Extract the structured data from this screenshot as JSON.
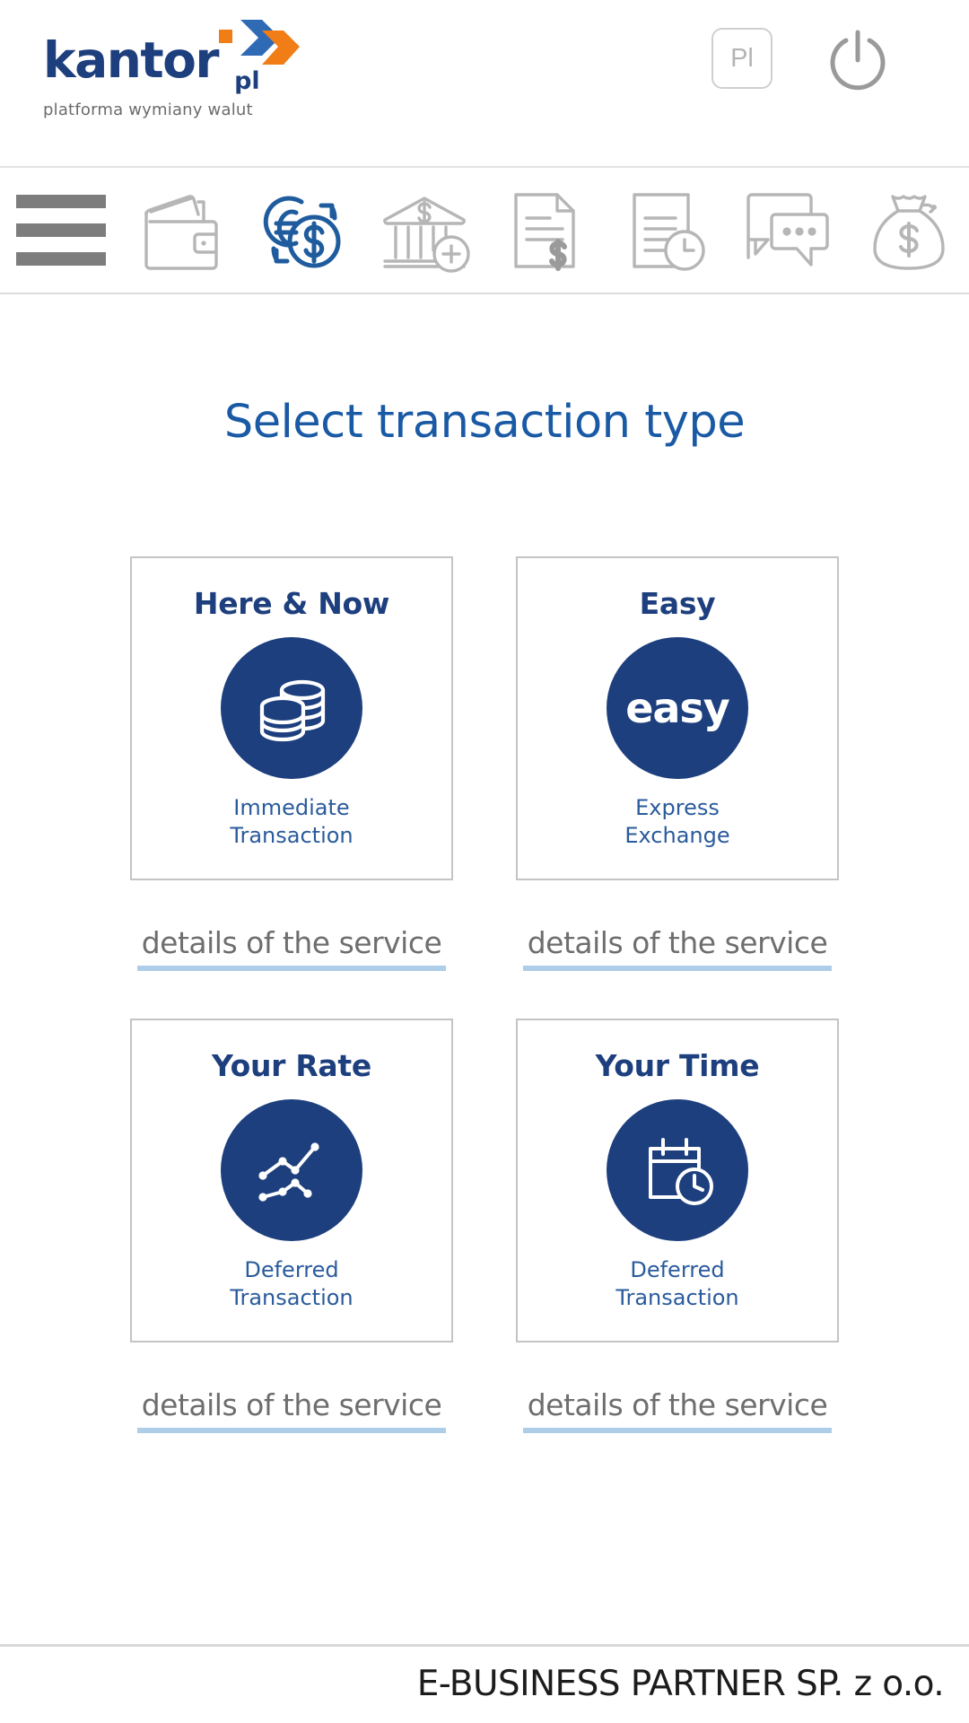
{
  "header": {
    "logo": {
      "word": "kantor",
      "dot_icon": "orange-square-dot",
      "tld": "pl",
      "tagline": "platforma wymiany walut",
      "chevron_icon": "double-chevron-logo",
      "blue": "#1d3f7e",
      "orange": "#f07d16"
    },
    "language_button": {
      "label": "Pl",
      "name": "language-switch-button"
    },
    "power_button": {
      "icon": "power-icon",
      "name": "logout-power-button"
    }
  },
  "nav": {
    "items": [
      {
        "icon": "hamburger-menu-icon",
        "name": "nav-menu-toggle",
        "active": false
      },
      {
        "icon": "wallet-icon",
        "name": "nav-item-wallet",
        "active": false
      },
      {
        "icon": "currency-exchange-icon",
        "name": "nav-item-exchange",
        "active": true
      },
      {
        "icon": "bank-add-icon",
        "name": "nav-item-bank-accounts",
        "active": false
      },
      {
        "icon": "invoice-dollar-icon",
        "name": "nav-item-invoices",
        "active": false
      },
      {
        "icon": "document-clock-icon",
        "name": "nav-item-history",
        "active": false
      },
      {
        "icon": "chat-bubbles-icon",
        "name": "nav-item-messages",
        "active": false
      },
      {
        "icon": "money-bag-icon",
        "name": "nav-item-funds",
        "active": false
      }
    ],
    "active_color": "#1f5c9e",
    "inactive_color": "#b6b6b6"
  },
  "main": {
    "title": "Select transaction type",
    "title_color": "#1a5aa5",
    "details_label": "details of the service",
    "cards": [
      {
        "title": "Here & Now",
        "icon": "coin-stacks-icon",
        "subtitle_line1": "Immediate",
        "subtitle_line2": "Transaction",
        "name": "card-here-and-now"
      },
      {
        "title": "Easy",
        "icon": "easy-wordmark-icon",
        "icon_text": "easy",
        "subtitle_line1": "Express",
        "subtitle_line2": "Exchange",
        "name": "card-easy"
      },
      {
        "title": "Your Rate",
        "icon": "line-chart-icon",
        "subtitle_line1": "Deferred",
        "subtitle_line2": "Transaction",
        "name": "card-your-rate"
      },
      {
        "title": "Your Time",
        "icon": "calendar-clock-icon",
        "subtitle_line1": "Deferred",
        "subtitle_line2": "Transaction",
        "name": "card-your-time"
      }
    ]
  },
  "footer": {
    "company": "E-BUSINESS PARTNER SP. z o.o."
  }
}
